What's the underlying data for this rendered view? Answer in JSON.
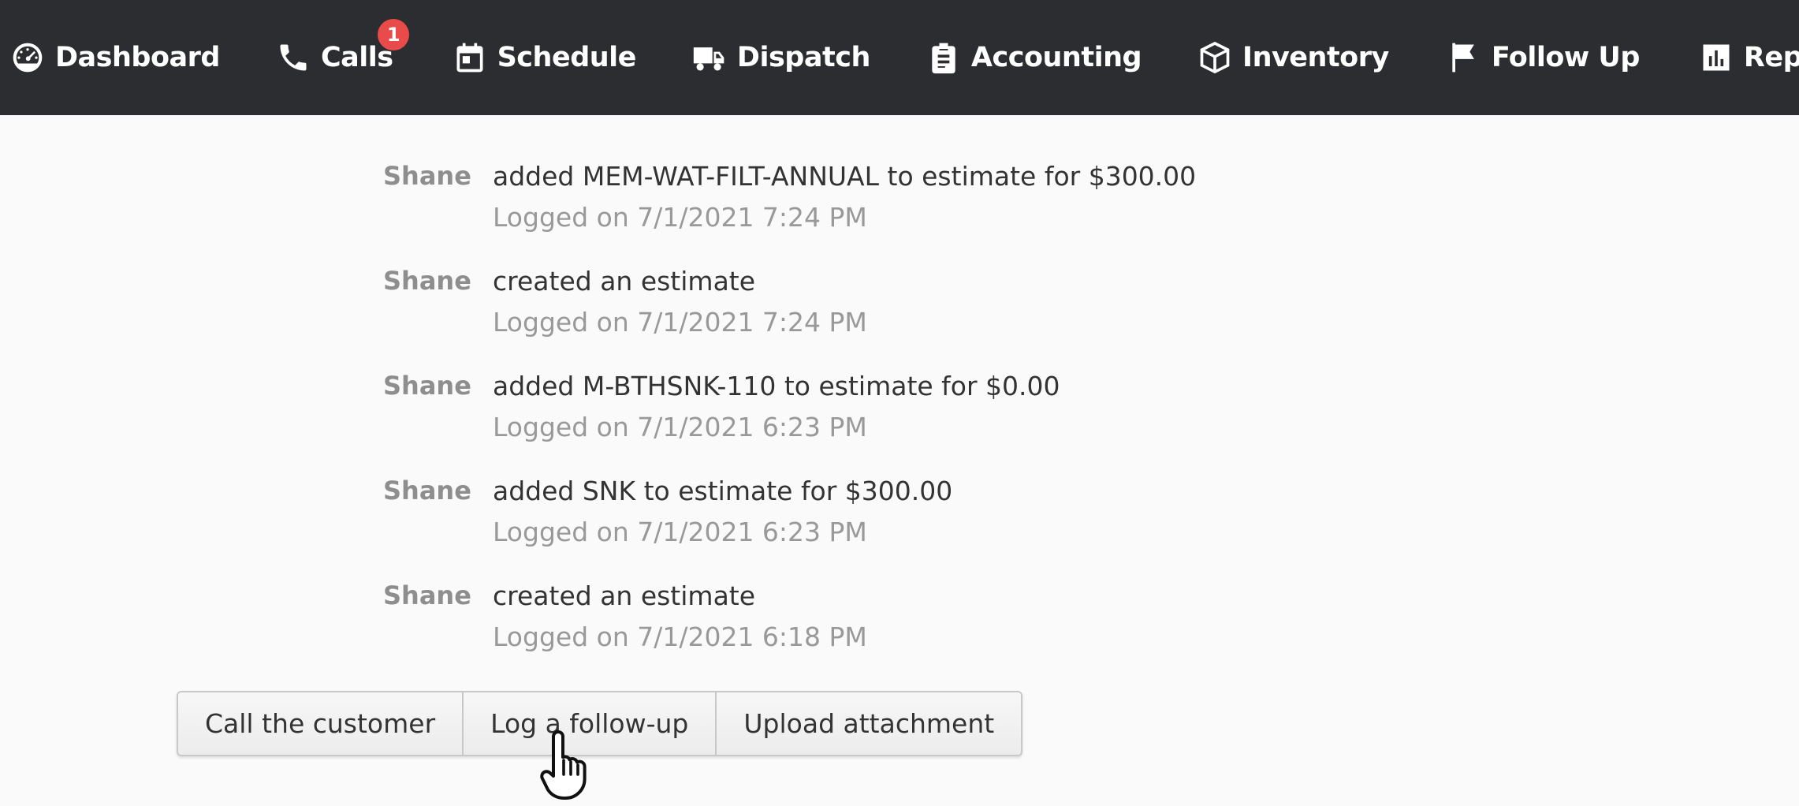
{
  "nav": {
    "items": [
      {
        "label": "Dashboard",
        "icon": "dashboard-gauge-icon"
      },
      {
        "label": "Calls",
        "icon": "phone-icon",
        "badge": "1"
      },
      {
        "label": "Schedule",
        "icon": "calendar-icon"
      },
      {
        "label": "Dispatch",
        "icon": "truck-icon"
      },
      {
        "label": "Accounting",
        "icon": "clipboard-icon"
      },
      {
        "label": "Inventory",
        "icon": "box-icon"
      },
      {
        "label": "Follow Up",
        "icon": "flag-icon"
      },
      {
        "label": "Reports",
        "icon": "bar-chart-icon"
      }
    ]
  },
  "log": {
    "entries": [
      {
        "author": "Shane",
        "message": "added MEM-WAT-FILT-ANNUAL to estimate for $300.00",
        "logged": "Logged on 7/1/2021 7:24 PM"
      },
      {
        "author": "Shane",
        "message": "created an estimate",
        "logged": "Logged on 7/1/2021 7:24 PM"
      },
      {
        "author": "Shane",
        "message": "added M-BTHSNK-110 to estimate for $0.00",
        "logged": "Logged on 7/1/2021 6:23 PM"
      },
      {
        "author": "Shane",
        "message": "added SNK to estimate for $300.00",
        "logged": "Logged on 7/1/2021 6:23 PM"
      },
      {
        "author": "Shane",
        "message": "created an estimate",
        "logged": "Logged on 7/1/2021 6:18 PM"
      }
    ]
  },
  "actions": {
    "call_label": "Call the customer",
    "followup_label": "Log a follow-up",
    "upload_label": "Upload attachment"
  },
  "colors": {
    "nav_bg": "#2c2d30",
    "badge": "#e94b4b"
  }
}
